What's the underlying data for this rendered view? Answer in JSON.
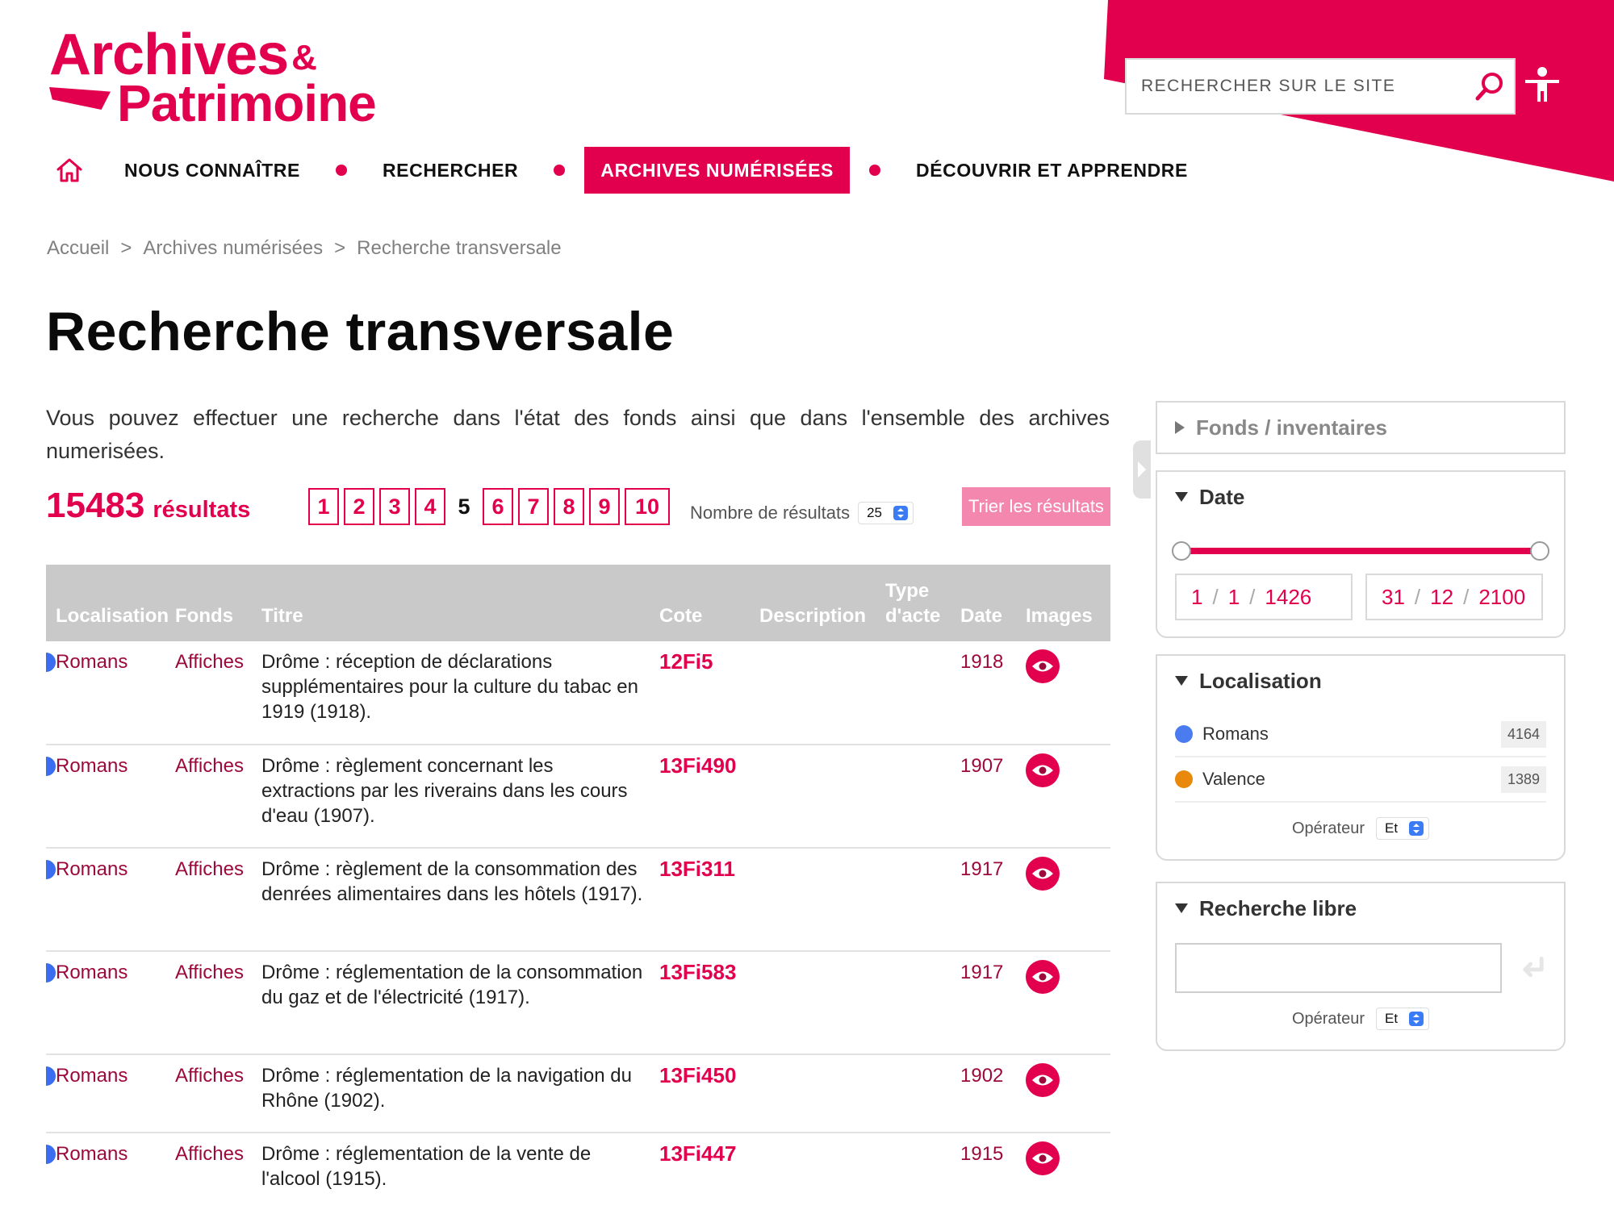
{
  "logo": {
    "line1": "Archives",
    "amp": "&",
    "line2": "Patrimoine"
  },
  "site_search": {
    "placeholder": "RECHERCHER SUR LE SITE"
  },
  "nav": {
    "items": [
      {
        "label": "NOUS CONNAÎTRE"
      },
      {
        "label": "RECHERCHER"
      },
      {
        "label": "ARCHIVES NUMÉRISÉES",
        "active": true
      },
      {
        "label": "DÉCOUVRIR ET APPRENDRE"
      }
    ]
  },
  "breadcrumb": {
    "items": [
      "Accueil",
      "Archives numérisées",
      "Recherche transversale"
    ],
    "separator": ">"
  },
  "page": {
    "title": "Recherche transversale",
    "intro": "Vous pouvez effectuer une recherche dans l'état des fonds ainsi que dans l'ensemble des archives numerisées."
  },
  "results": {
    "count": "15483",
    "count_label": "résultats",
    "pages": [
      "1",
      "2",
      "3",
      "4",
      "5",
      "6",
      "7",
      "8",
      "9",
      "10"
    ],
    "current_page": "5",
    "per_page_label": "Nombre de résultats",
    "per_page_value": "25",
    "sort_label": "Trier les résultats"
  },
  "table": {
    "headers": {
      "localisation": "Localisation",
      "fonds": "Fonds",
      "titre": "Titre",
      "cote": "Cote",
      "description": "Description",
      "type_acte": "Type d'acte",
      "date": "Date",
      "images": "Images"
    },
    "rows": [
      {
        "localisation": "Romans",
        "fonds": "Affiches",
        "titre": "Drôme : réception de déclarations supplémentaires pour la culture du tabac en 1919 (1918).",
        "cote": "12Fi5",
        "description": "",
        "type_acte": "",
        "date": "1918"
      },
      {
        "localisation": "Romans",
        "fonds": "Affiches",
        "titre": "Drôme : règlement concernant les extractions par les riverains dans les cours d'eau (1907).",
        "cote": "13Fi490",
        "description": "",
        "type_acte": "",
        "date": "1907"
      },
      {
        "localisation": "Romans",
        "fonds": "Affiches",
        "titre": "Drôme : règlement de la consommation des denrées alimentaires dans les hôtels (1917).",
        "cote": "13Fi311",
        "description": "",
        "type_acte": "",
        "date": "1917"
      },
      {
        "localisation": "Romans",
        "fonds": "Affiches",
        "titre": "Drôme : réglementation de la consommation du gaz et de l'électricité (1917).",
        "cote": "13Fi583",
        "description": "",
        "type_acte": "",
        "date": "1917"
      },
      {
        "localisation": "Romans",
        "fonds": "Affiches",
        "titre": "Drôme : réglementation de la navigation du Rhône (1902).",
        "cote": "13Fi450",
        "description": "",
        "type_acte": "",
        "date": "1902"
      },
      {
        "localisation": "Romans",
        "fonds": "Affiches",
        "titre": "Drôme : réglementation de la vente de l'alcool (1915).",
        "cote": "13Fi447",
        "description": "",
        "type_acte": "",
        "date": "1915"
      }
    ]
  },
  "sidebar": {
    "fonds": {
      "title": "Fonds / inventaires"
    },
    "date": {
      "title": "Date",
      "start": {
        "day": "1",
        "month": "1",
        "year": "1426"
      },
      "end": {
        "day": "31",
        "month": "12",
        "year": "2100"
      },
      "separator": "/"
    },
    "localisation": {
      "title": "Localisation",
      "items": [
        {
          "label": "Romans",
          "count": "4164",
          "color": "#4a7cf0"
        },
        {
          "label": "Valence",
          "count": "1389",
          "color": "#e8890c"
        }
      ],
      "operator_label": "Opérateur",
      "operator_value": "Et"
    },
    "free_search": {
      "title": "Recherche libre",
      "value": "",
      "operator_label": "Opérateur",
      "operator_value": "Et"
    }
  },
  "colors": {
    "brand": "#e2004e",
    "dark_brand": "#9c0a3c",
    "sort_button": "#f487ad",
    "table_header": "#c9c9c9"
  }
}
